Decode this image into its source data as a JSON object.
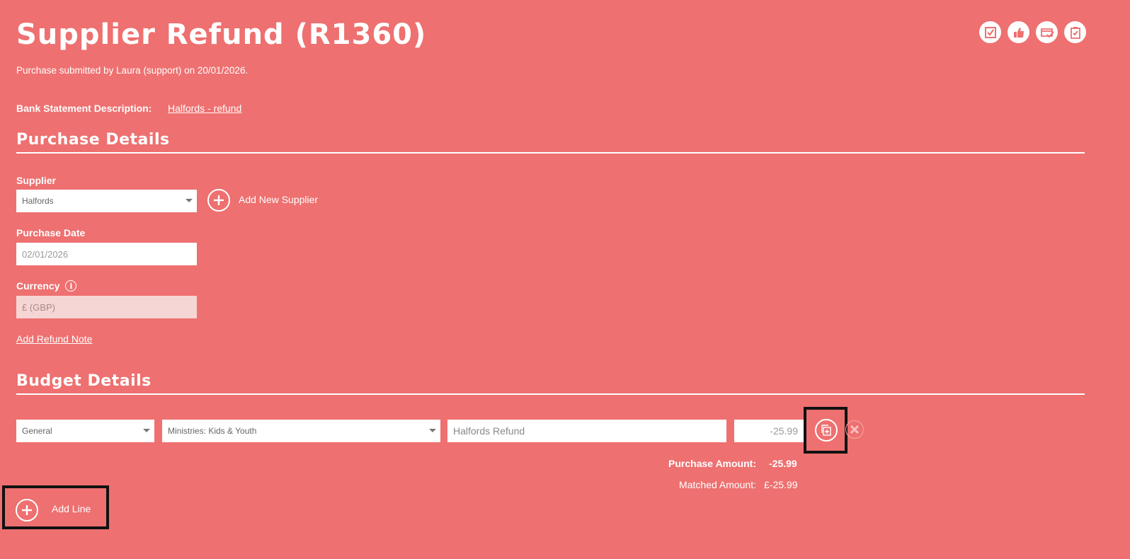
{
  "header": {
    "title": "Supplier Refund (R1360)",
    "subtitle": "Purchase submitted by Laura (support) on 20/01/2026.",
    "icons": [
      "checkbox-icon",
      "thumbs-up-icon",
      "card-check-icon",
      "clipboard-check-icon"
    ]
  },
  "bank": {
    "label": "Bank Statement Description:",
    "value": "Halfords - refund"
  },
  "purchase_details": {
    "heading": "Purchase Details",
    "supplier_label": "Supplier",
    "supplier_value": "Halfords",
    "add_supplier_label": "Add New Supplier",
    "date_label": "Purchase Date",
    "date_value": "02/01/2026",
    "currency_label": "Currency",
    "currency_value": "£ (GBP)",
    "add_refund_note": "Add Refund Note"
  },
  "budget_details": {
    "heading": "Budget Details",
    "line": {
      "fund": "General",
      "category": "Ministries: Kids & Youth",
      "description": "Halfords Refund",
      "amount": "-25.99"
    },
    "purchase_amount_label": "Purchase Amount:",
    "purchase_amount_value": "-25.99",
    "matched_amount_label": "Matched Amount:",
    "matched_amount_value": "£-25.99",
    "add_line_label": "Add Line"
  },
  "colors": {
    "background": "#ee7070",
    "text": "#ffffff",
    "highlight": "#111111"
  }
}
